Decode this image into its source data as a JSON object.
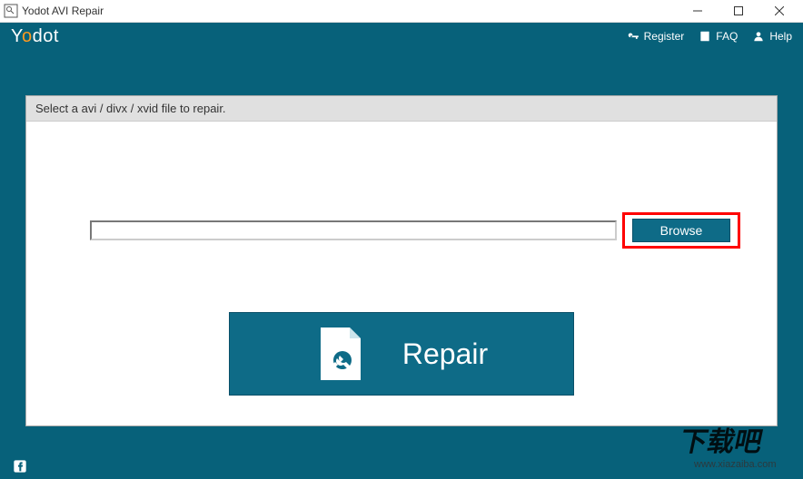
{
  "titlebar": {
    "title": "Yodot AVI Repair"
  },
  "header": {
    "logo": "Yodot",
    "links": {
      "register": "Register",
      "faq": "FAQ",
      "help": "Help"
    }
  },
  "instruction": "Select a avi / divx / xvid file to repair.",
  "file_path": "",
  "buttons": {
    "browse": "Browse",
    "repair": "Repair"
  },
  "watermark": {
    "line1": "下载吧",
    "line2": "www.xiazaiba.com"
  }
}
